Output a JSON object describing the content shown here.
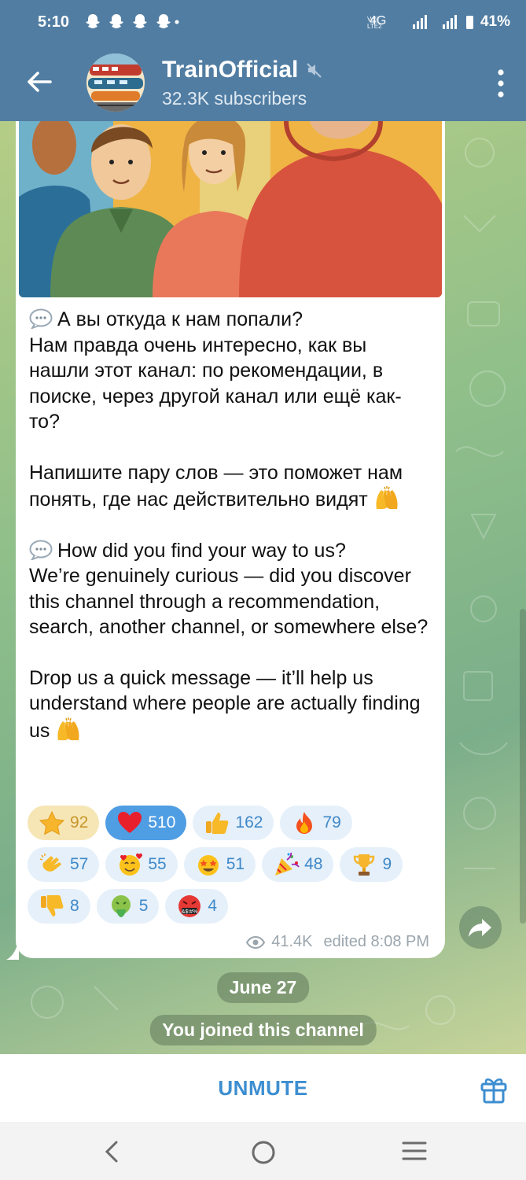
{
  "status_bar": {
    "time": "5:10",
    "network": "4G",
    "battery": "41%"
  },
  "header": {
    "channel_name": "TrainOfficial",
    "subscribers": "32.3K subscribers"
  },
  "message": {
    "ru_question": "А вы откуда к нам попали?",
    "ru_body": "Нам правда очень интересно, как вы нашли этот канал: по рекомендации, в поиске, через другой канал или ещё как-то?",
    "ru_call": "Напишите пару слов — это поможет нам понять, где нас действительно видят",
    "en_question": "How did you find your way to us?",
    "en_body": "We’re genuinely curious — did you discover this channel through a recommendation, search, another channel, or somewhere else?",
    "en_call": "Drop us a quick message — it’ll help us understand where people are actually finding us",
    "views": "41.4K",
    "edited": "edited 8:08 PM"
  },
  "reactions": [
    {
      "icon": "star",
      "count": "92"
    },
    {
      "icon": "red-heart",
      "count": "510"
    },
    {
      "icon": "thumbs-up",
      "count": "162"
    },
    {
      "icon": "fire",
      "count": "79"
    },
    {
      "icon": "clapping-hands",
      "count": "57"
    },
    {
      "icon": "smiling-face-with-hearts",
      "count": "55"
    },
    {
      "icon": "star-struck",
      "count": "51"
    },
    {
      "icon": "party-popper",
      "count": "48"
    },
    {
      "icon": "trophy",
      "count": "9"
    },
    {
      "icon": "thumbs-down",
      "count": "8"
    },
    {
      "icon": "vomiting-face",
      "count": "5"
    },
    {
      "icon": "cursing-face",
      "count": "4"
    }
  ],
  "service_messages": {
    "date": "June 27",
    "joined": "You joined this channel"
  },
  "bottom_bar": {
    "unmute_label": "UNMUTE"
  },
  "colors": {
    "header_bg": "#517da2",
    "accent": "#3d8ed0",
    "heart_chip": "#4f9de3",
    "star_chip": "#f6e6b5"
  }
}
